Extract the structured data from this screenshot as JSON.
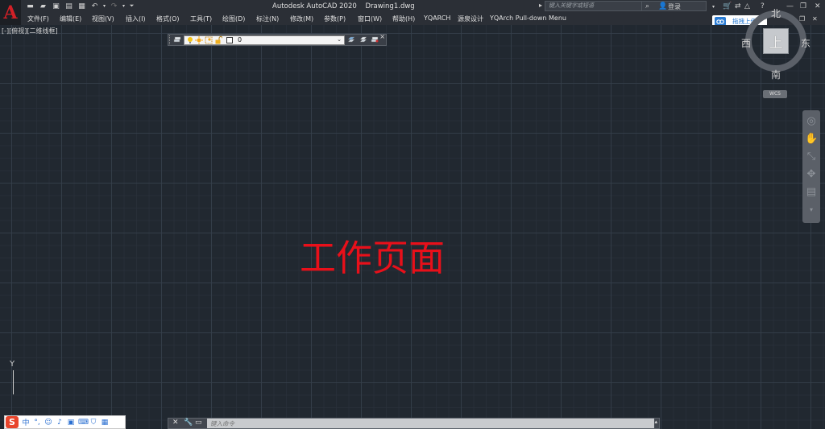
{
  "titlebar": {
    "app_letter": "A",
    "title": "Autodesk AutoCAD 2020",
    "document": "Drawing1.dwg",
    "search_placeholder": "键入关键字或短语",
    "login": "登录",
    "quick_access": [
      "new-icon",
      "open-icon",
      "save-icon",
      "saveas-icon",
      "print-icon",
      "undo-icon",
      "redo-icon",
      "customize-icon"
    ]
  },
  "menu": {
    "items": [
      "文件(F)",
      "编辑(E)",
      "视图(V)",
      "插入(I)",
      "格式(O)",
      "工具(T)",
      "绘图(D)",
      "标注(N)",
      "修改(M)",
      "参数(P)",
      "窗口(W)",
      "帮助(H)",
      "YQARCH",
      "源泉设计",
      "YQArch Pull-down Menu"
    ]
  },
  "upload_button": "拖拽上传",
  "viewport": {
    "label": "[-][俯视][二维线框]",
    "annotation": "工作页面"
  },
  "layer_toolbar": {
    "current_layer": "0"
  },
  "viewcube": {
    "face": "上",
    "north": "北",
    "south": "南",
    "east": "东",
    "west": "西",
    "wcs": "WCS"
  },
  "ucs": {
    "y_label": "Y"
  },
  "ime": {
    "logo": "S",
    "mode": "中"
  },
  "command_line": {
    "placeholder": "键入命令"
  },
  "colors": {
    "canvas": "#212830",
    "annotation": "#e8101a",
    "logo": "#d32027"
  }
}
